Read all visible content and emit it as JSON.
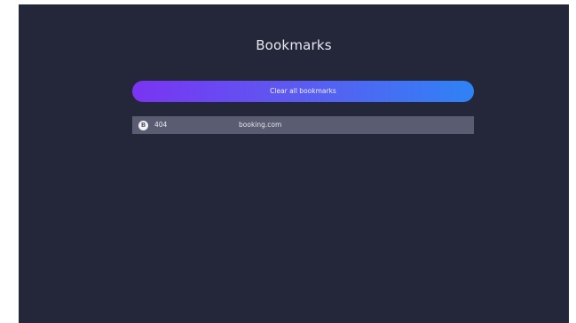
{
  "page": {
    "title": "Bookmarks"
  },
  "actions": {
    "clear_all_label": "Clear all bookmarks"
  },
  "bookmarks": [
    {
      "icon": "B",
      "icon_name": "booking-favicon-icon",
      "title": "404",
      "url": "booking.com"
    }
  ],
  "colors": {
    "background": "#242739",
    "row": "#5a5c72",
    "gradient_start": "#7a34f2",
    "gradient_end": "#2f82f6"
  }
}
